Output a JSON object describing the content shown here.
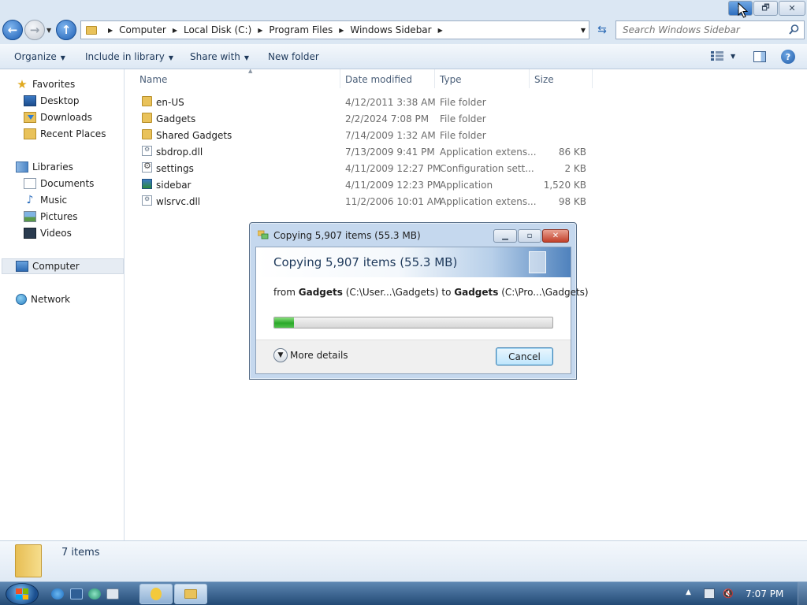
{
  "window": {
    "caption_buttons": {
      "minimize": "▬",
      "maximize": "🗗",
      "close": "✕"
    }
  },
  "nav": {
    "back_icon": "←",
    "forward_icon": "→",
    "up_icon": "↑"
  },
  "address": {
    "crumbs": [
      "Computer",
      "Local Disk (C:)",
      "Program Files",
      "Windows Sidebar"
    ]
  },
  "search": {
    "placeholder": "Search Windows Sidebar"
  },
  "commands": {
    "organize": "Organize",
    "include_in_library": "Include in library",
    "share_with": "Share with",
    "new_folder": "New folder",
    "help": "?"
  },
  "sidebar": {
    "favorites": {
      "label": "Favorites",
      "items": [
        "Desktop",
        "Downloads",
        "Recent Places"
      ]
    },
    "libraries": {
      "label": "Libraries",
      "items": [
        "Documents",
        "Music",
        "Pictures",
        "Videos"
      ]
    },
    "computer": "Computer",
    "network": "Network"
  },
  "filelist": {
    "columns": {
      "name": "Name",
      "date": "Date modified",
      "type": "Type",
      "size": "Size"
    },
    "rows": [
      {
        "name": "en-US",
        "date": "4/12/2011 3:38 AM",
        "type": "File folder",
        "size": "",
        "icon": "folder"
      },
      {
        "name": "Gadgets",
        "date": "2/2/2024 7:08 PM",
        "type": "File folder",
        "size": "",
        "icon": "folder"
      },
      {
        "name": "Shared Gadgets",
        "date": "7/14/2009 1:32 AM",
        "type": "File folder",
        "size": "",
        "icon": "folder"
      },
      {
        "name": "sbdrop.dll",
        "date": "7/13/2009 9:41 PM",
        "type": "Application extens...",
        "size": "86 KB",
        "icon": "dll"
      },
      {
        "name": "settings",
        "date": "4/11/2009 12:27 PM",
        "type": "Configuration sett...",
        "size": "2 KB",
        "icon": "cfg"
      },
      {
        "name": "sidebar",
        "date": "4/11/2009 12:23 PM",
        "type": "Application",
        "size": "1,520 KB",
        "icon": "app"
      },
      {
        "name": "wlsrvc.dll",
        "date": "11/2/2006 10:01 AM",
        "type": "Application extens...",
        "size": "98 KB",
        "icon": "dll"
      }
    ]
  },
  "details": {
    "item_count": "7 items"
  },
  "dialog": {
    "title": "Copying 5,907 items (55.3 MB)",
    "heading": "Copying 5,907 items (55.3 MB)",
    "from_prefix": "from",
    "from_name": "Gadgets",
    "from_path": "(C:\\User...\\Gadgets)",
    "to_prefix": "to",
    "to_name": "Gadgets",
    "to_path": "(C:\\Pro...\\Gadgets)",
    "progress_fraction": 0.07,
    "more_details": "More details",
    "cancel": "Cancel",
    "min_icon": "▁",
    "max_icon": "▫",
    "close_icon": "✕"
  },
  "taskbar": {
    "clock": "7:07 PM"
  },
  "colors": {
    "accent": "#2b6ab5",
    "progress": "#2ba82a"
  }
}
